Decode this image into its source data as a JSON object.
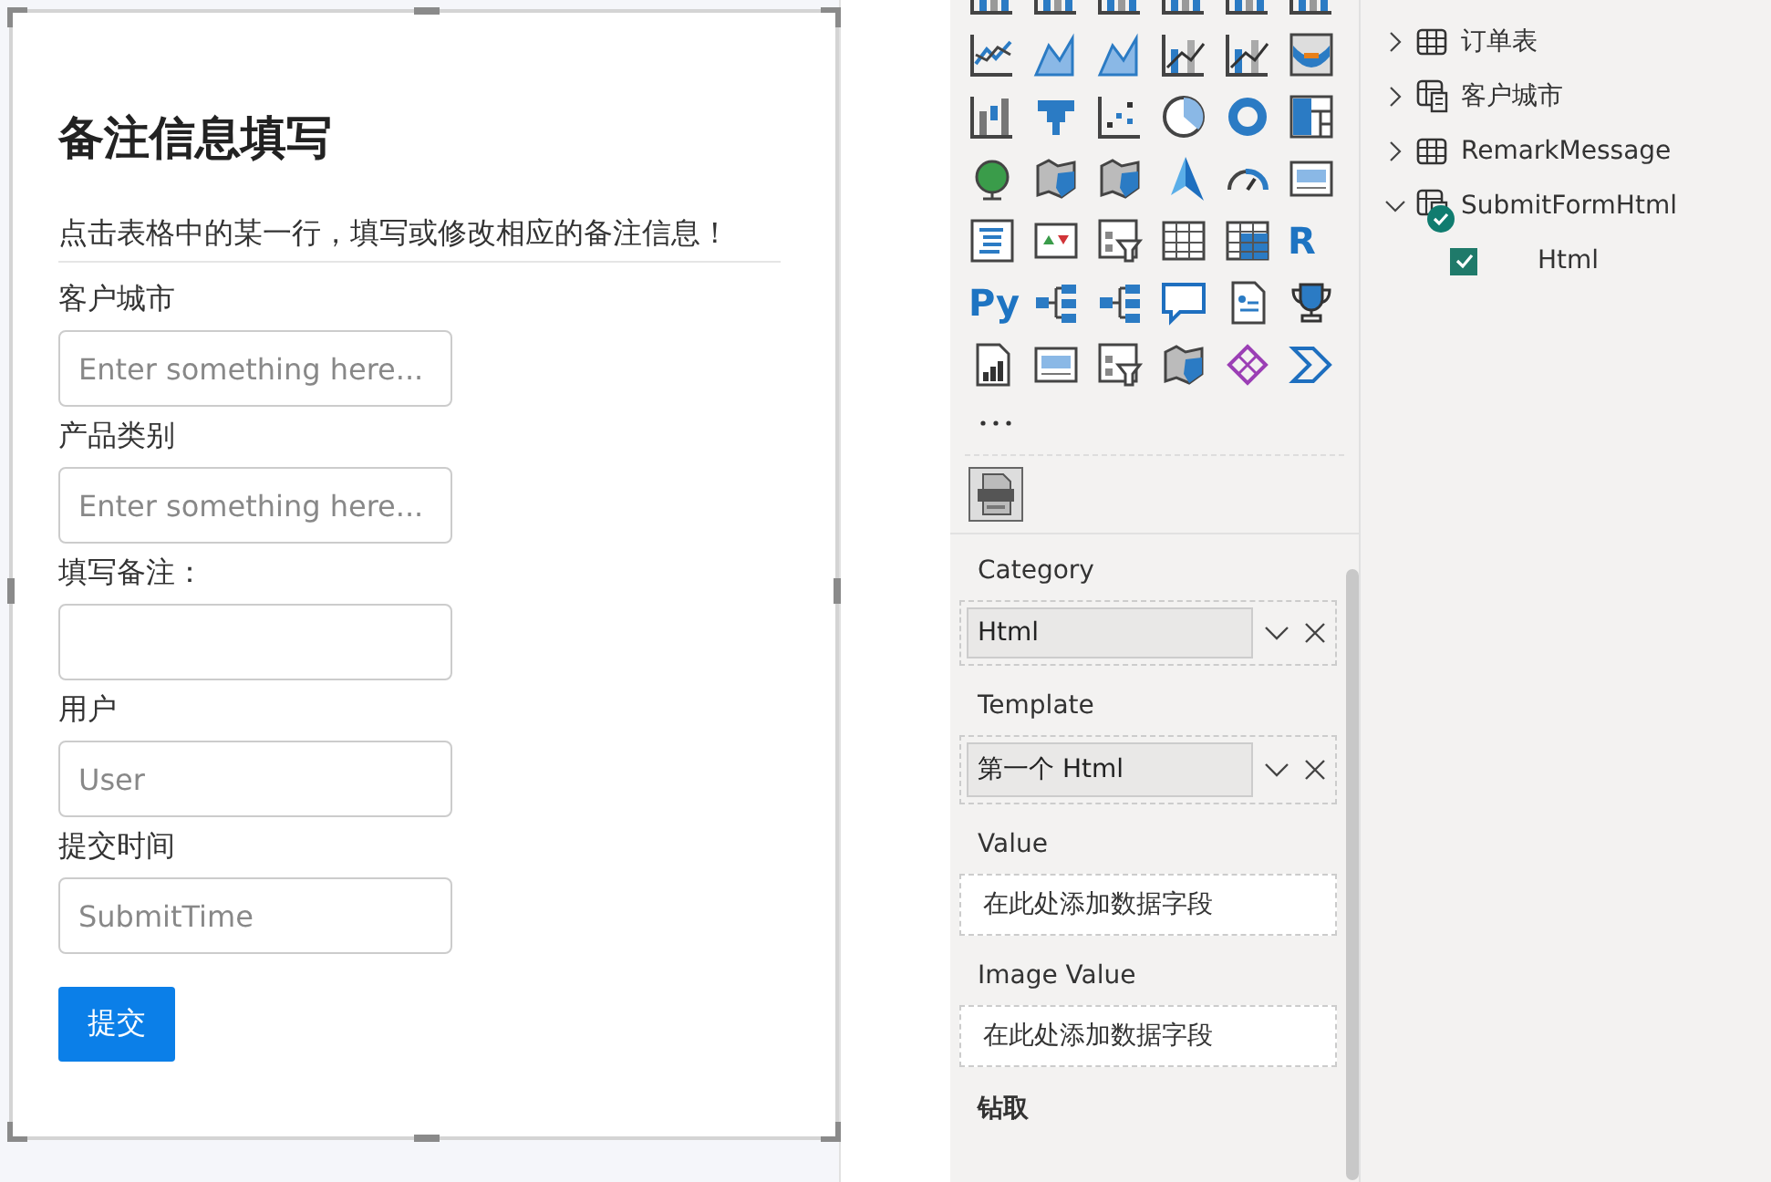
{
  "form": {
    "title": "备注信息填写",
    "intro": "点击表格中的某一行，填写或修改相应的备注信息！",
    "fields": [
      {
        "label": "客户城市",
        "placeholder": "Enter something here..."
      },
      {
        "label": "产品类别",
        "placeholder": "Enter something here..."
      },
      {
        "label": "填写备注："
      },
      {
        "label": "用户",
        "placeholder": "User"
      },
      {
        "label": "提交时间",
        "placeholder": "SubmitTime"
      }
    ],
    "submit": "提交"
  },
  "visualizations": {
    "letter_icons": [
      "R",
      "Py"
    ],
    "wells": [
      {
        "label": "Category",
        "kind": "field",
        "value": "Html"
      },
      {
        "label": "Template",
        "kind": "field",
        "value": "第一个 Html"
      },
      {
        "label": "Value",
        "kind": "empty",
        "placeholder": "在此处添加数据字段"
      },
      {
        "label": "Image Value",
        "kind": "empty",
        "placeholder": "在此处添加数据字段"
      }
    ],
    "section": "钻取"
  },
  "fields_pane": {
    "tables": [
      {
        "name": "订单表",
        "kind": "table",
        "expanded": false
      },
      {
        "name": "客户城市",
        "kind": "calc",
        "expanded": false
      },
      {
        "name": "RemarkMessage",
        "kind": "table",
        "expanded": false
      },
      {
        "name": "SubmitFormHtml",
        "kind": "calc-used",
        "expanded": true,
        "children": [
          {
            "name": "Html",
            "checked": true
          }
        ]
      }
    ]
  }
}
